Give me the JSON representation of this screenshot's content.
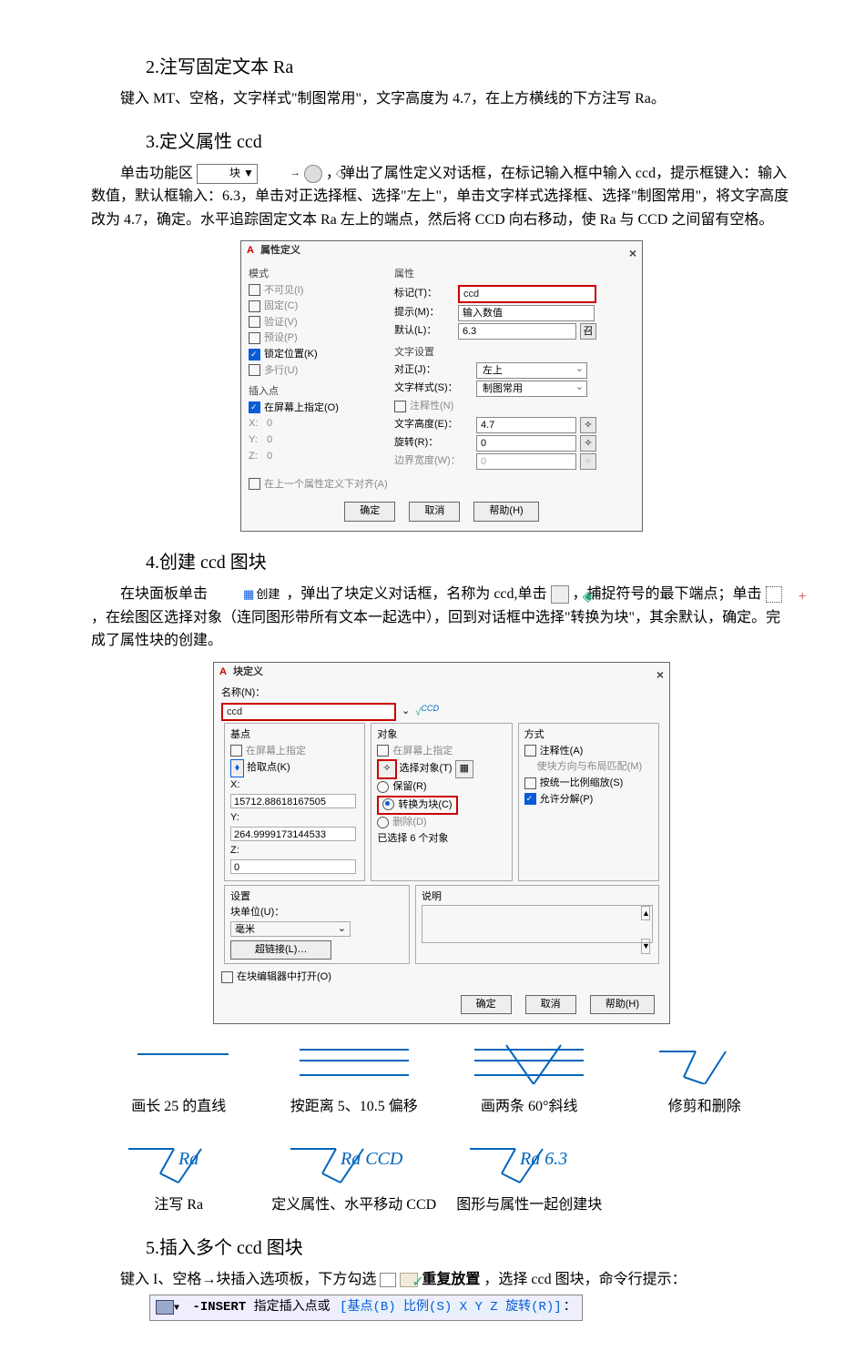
{
  "sec2": {
    "heading": "2.注写固定文本 Ra",
    "p1": "键入 MT、空格，文字样式\"制图常用\"，文字高度为 4.7，在上方横线的下方注写 Ra。"
  },
  "sec3": {
    "heading": "3.定义属性 ccd",
    "p1_pre": "单击功能区",
    "p1_btn": "块 ▼",
    "p1_arrow": "→",
    "p1_post": "，弹出了属性定义对话框，在标记输入框中输入 ccd，提示框键入：输入数值，默认框输入：6.3，单击对正选择框、选择\"左上\"，单击文字样式选择框、选择\"制图常用\"，将文字高度改为 4.7，确定。水平追踪固定文本 Ra 左上的端点，然后将 CCD 向右移动，使 Ra 与 CCD 之间留有空格。"
  },
  "dlg1": {
    "title": "属性定义",
    "mode_label": "模式",
    "mode": {
      "inv": "不可见(I)",
      "const": "固定(C)",
      "verify": "验证(V)",
      "preset": "预设(P)",
      "lock": "锁定位置(K)",
      "multi": "多行(U)"
    },
    "prop_label": "属性",
    "tag_l": "标记(T)：",
    "tag_v": "ccd",
    "prompt_l": "提示(M)：",
    "prompt_v": "输入数值",
    "default_l": "默认(L)：",
    "default_v": "6.3",
    "ins_label": "插入点",
    "ins_onscreen": "在屏幕上指定(O)",
    "x": "X:",
    "y": "Y:",
    "z": "Z:",
    "zero": "0",
    "txt_label": "文字设置",
    "justify_l": "对正(J)：",
    "justify_v": "左上",
    "style_l": "文字样式(S)：",
    "style_v": "制图常用",
    "annot": "注释性(N)",
    "height_l": "文字高度(E)：",
    "height_v": "4.7",
    "rot_l": "旋转(R)：",
    "rot_v": "0",
    "bw_l": "边界宽度(W)：",
    "bw_v": "0",
    "align": "在上一个属性定义下对齐(A)",
    "ok": "确定",
    "cancel": "取消",
    "help": "帮助(H)"
  },
  "sec4": {
    "heading": "4.创建 ccd 图块",
    "p1a": "在块面板单击",
    "create_label": "创建",
    "p1b": "，弹出了块定义对话框，名称为 ccd,单击",
    "p1c": "，捕捉符号的最下端点；单击",
    "p1d": "，在绘图区选择对象（连同图形带所有文本一起选中），回到对话框中选择\"转换为块\"，其余默认，确定。完成了属性块的创建。"
  },
  "dlg2": {
    "title": "块定义",
    "name_l": "名称(N)：",
    "name_v": "ccd",
    "base_label": "基点",
    "obj_label": "对象",
    "mode_label": "方式",
    "onscreen": "在屏幕上指定",
    "pickpt": "拾取点(K)",
    "selobj": "选择对象(T)",
    "x_l": "X:",
    "x_v": "15712.88618167505",
    "y_l": "Y:",
    "y_v": "264.9999173144533",
    "z_l": "Z:",
    "z_v": "0",
    "retain": "保留(R)",
    "convert": "转换为块(C)",
    "delete": "删除(D)",
    "selcount": "已选择 6 个对象",
    "annot": "注释性(A)",
    "match": "使块方向与布局匹配(M)",
    "scale": "按统一比例缩放(S)",
    "explode": "允许分解(P)",
    "settings_l": "设置",
    "unit_l": "块单位(U)：",
    "unit_v": "毫米",
    "hyper": "超链接(L)…",
    "desc_l": "说明",
    "openbe": "在块编辑器中打开(O)",
    "ok": "确定",
    "cancel": "取消",
    "help": "帮助(H)"
  },
  "diag": {
    "c1": "画长 25 的直线",
    "c2": "按距离 5、10.5 偏移",
    "c3": "画两条 60°斜线",
    "c4": "修剪和删除",
    "c5": "注写 Ra",
    "c6": "定义属性、水平移动 CCD",
    "c7": "图形与属性一起创建块",
    "r1": "Ra",
    "r2": "Ra CCD",
    "r3": "Ra 6.3"
  },
  "sec5": {
    "heading": "5.插入多个 ccd 图块",
    "p1a": "键入 I、空格→块插入选项板，下方勾选",
    "repeat": "重复放置",
    "p1b": "，选择 ccd 图块，命令行提示：",
    "cmd_insert": "-INSERT",
    "cmd_rest": " 指定插入点或 ",
    "cmd_opts": "[基点(B) 比例(S) X Y Z 旋转(R)]",
    "cmd_tail": "："
  }
}
